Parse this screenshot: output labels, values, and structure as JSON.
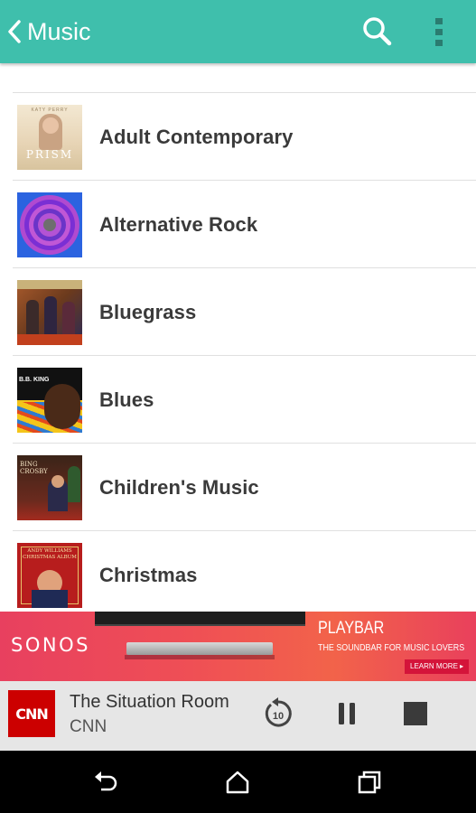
{
  "appbar": {
    "title": "Music",
    "back_icon": "chevron-left-icon",
    "search_icon": "search-icon",
    "more_icon": "more-vert-icon",
    "color": "#3fbfac"
  },
  "genres": [
    {
      "label": "Adult Contemporary",
      "art_text": "PRISM"
    },
    {
      "label": "Alternative Rock"
    },
    {
      "label": "Bluegrass"
    },
    {
      "label": "Blues",
      "art_text": "B.B. KING"
    },
    {
      "label": "Children's Music",
      "art_text": "BING CROSBY"
    },
    {
      "label": "Christmas",
      "art_text": "ANDY WILLIAMS CHRISTMAS ALBUM"
    }
  ],
  "ad": {
    "brand": "SONOS",
    "headline": "PLAYBAR",
    "subline": "THE SOUNDBAR FOR MUSIC LOVERS",
    "cta": "LEARN MORE ▸"
  },
  "now_playing": {
    "art_text": "CNN",
    "title": "The Situation Room",
    "artist": "CNN",
    "replay_label": "10",
    "accent": "#cc0000"
  },
  "system_nav": {
    "back_icon": "back-icon",
    "home_icon": "home-icon",
    "recents_icon": "recents-icon"
  }
}
